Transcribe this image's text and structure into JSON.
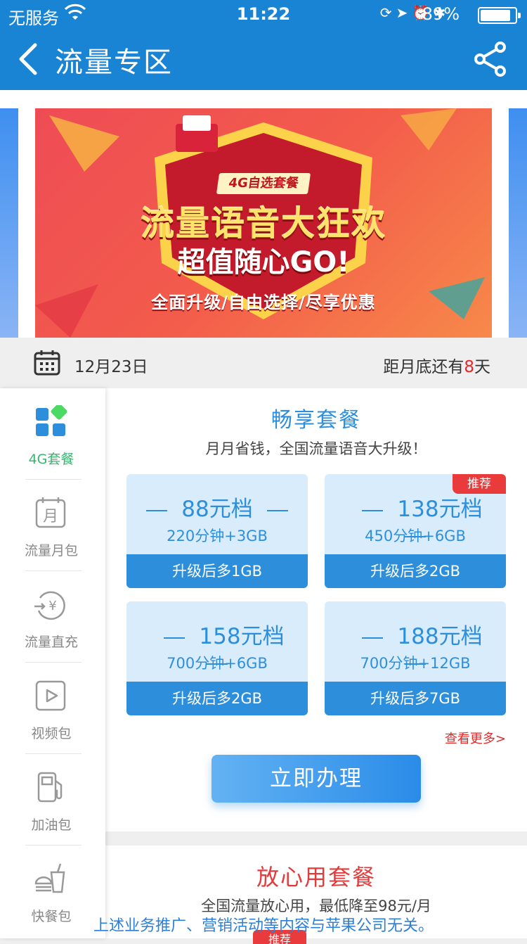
{
  "status_bar": {
    "carrier": "无服务",
    "time": "11:22",
    "battery": "89%"
  },
  "nav": {
    "title": "流量专区"
  },
  "banner": {
    "tag": "4G自选套餐",
    "headline": "流量语音大狂欢",
    "sub": "超值随心GO!",
    "slogan": "全面升级/自由选择/尽享优惠"
  },
  "date_bar": {
    "date": "12月23日",
    "remain_prefix": "距月底还有",
    "remain_days": "8",
    "remain_suffix": "天"
  },
  "sidebar": {
    "items": [
      {
        "label": "4G套餐",
        "icon": "4g-package-icon",
        "active": true
      },
      {
        "label": "流量月包",
        "icon": "monthly-calendar-icon"
      },
      {
        "label": "流量直充",
        "icon": "yuan-recharge-icon"
      },
      {
        "label": "视频包",
        "icon": "video-play-icon"
      },
      {
        "label": "加油包",
        "icon": "fuel-pump-icon"
      },
      {
        "label": "快餐包",
        "icon": "fast-food-icon"
      }
    ]
  },
  "section1": {
    "title": "畅享套餐",
    "subtitle": "月月省钱，全国流量语音大升级！",
    "plans": [
      {
        "price": "88元档",
        "detail": "220分钟+3GB",
        "upgrade": "升级后多1GB"
      },
      {
        "price": "138元档",
        "detail": "450分钟+6GB",
        "upgrade": "升级后多2GB",
        "badge": "推荐"
      },
      {
        "price": "158元档",
        "detail": "700分钟+6GB",
        "upgrade": "升级后多2GB"
      },
      {
        "price": "188元档",
        "detail": "700分钟+12GB",
        "upgrade": "升级后多7GB"
      }
    ],
    "more_link": "查看更多>",
    "apply_button": "立即办理"
  },
  "section2": {
    "title": "放心用套餐",
    "subtitle": "全国流量放心用，最低降至98元/月",
    "badge": "推荐"
  },
  "disclaimer": "上述业务推广、营销活动等内容与苹果公司无关。",
  "colors": {
    "primary": "#1a84d4",
    "accent_blue": "#2d8fdc",
    "accent_red": "#e93b3b",
    "active_green": "#3cb371"
  }
}
